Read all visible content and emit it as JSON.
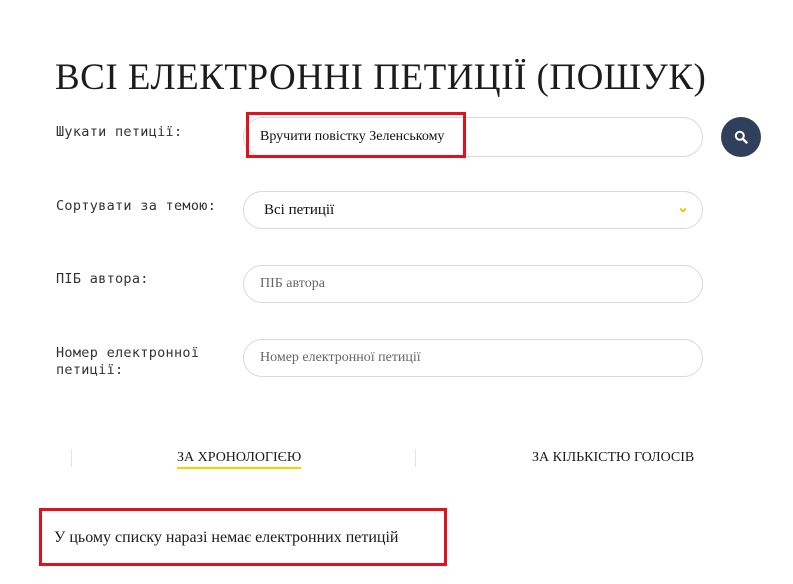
{
  "page_title": "ВСІ ЕЛЕКТРОННІ ПЕТИЦІЇ (ПОШУК)",
  "search": {
    "label": "Шукати петиції:",
    "value": "Вручити повістку Зеленському",
    "button_icon": "search-icon"
  },
  "topic": {
    "label": "Сортувати за темою:",
    "selected": "Всі петиції",
    "icon": "chevron-down-icon"
  },
  "author": {
    "label": "ПІБ автора:",
    "placeholder": "ПІБ автора"
  },
  "number": {
    "label": "Номер електронної петиції:",
    "placeholder": "Номер електронної петиції"
  },
  "sort_tabs": {
    "chronology": "ЗА ХРОНОЛОГІЄЮ",
    "votes": "ЗА КІЛЬКІСТЮ ГОЛОСІВ"
  },
  "empty_message": "У цьому списку наразі немає електронних петицій",
  "colors": {
    "highlight_box": "#e0121b",
    "search_button": "#2f3f5c",
    "active_underline": "#f2d200",
    "chevron": "#e6c200"
  }
}
